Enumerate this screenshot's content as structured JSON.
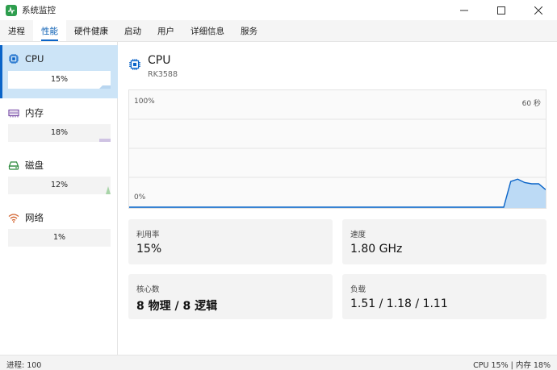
{
  "window": {
    "title": "系统监控",
    "accent": "#0a64c8"
  },
  "tabs": [
    {
      "label": "进程",
      "active": false
    },
    {
      "label": "性能",
      "active": true
    },
    {
      "label": "硬件健康",
      "active": false
    },
    {
      "label": "启动",
      "active": false
    },
    {
      "label": "用户",
      "active": false
    },
    {
      "label": "详细信息",
      "active": false
    },
    {
      "label": "服务",
      "active": false
    }
  ],
  "sidebar": {
    "items": [
      {
        "label": "CPU",
        "icon": "cpu-icon",
        "usage_text": "15%",
        "usage": 15,
        "selected": true
      },
      {
        "label": "内存",
        "icon": "memory-icon",
        "usage_text": "18%",
        "usage": 18,
        "selected": false
      },
      {
        "label": "磁盘",
        "icon": "disk-icon",
        "usage_text": "12%",
        "usage": 12,
        "selected": false
      },
      {
        "label": "网络",
        "icon": "wifi-icon",
        "usage_text": "1%",
        "usage": 1,
        "selected": false
      }
    ]
  },
  "main": {
    "title": "CPU",
    "subtitle": "RK3588",
    "graph": {
      "top_label": "100%",
      "bottom_label": "0%",
      "time_label": "60 秒",
      "ylim": [
        0,
        100
      ],
      "recent_values": [
        0,
        22,
        24,
        21,
        20,
        20,
        15
      ]
    },
    "cards": [
      {
        "label": "利用率",
        "value": "15%"
      },
      {
        "label": "速度",
        "value": "1.80 GHz"
      },
      {
        "label": "核心数",
        "value": "8 物理 / 8 逻辑"
      },
      {
        "label": "负载",
        "value": "1.51 / 1.18 / 1.11"
      }
    ]
  },
  "status": {
    "left": "进程: 100",
    "right": "CPU 15% | 内存 18%"
  }
}
